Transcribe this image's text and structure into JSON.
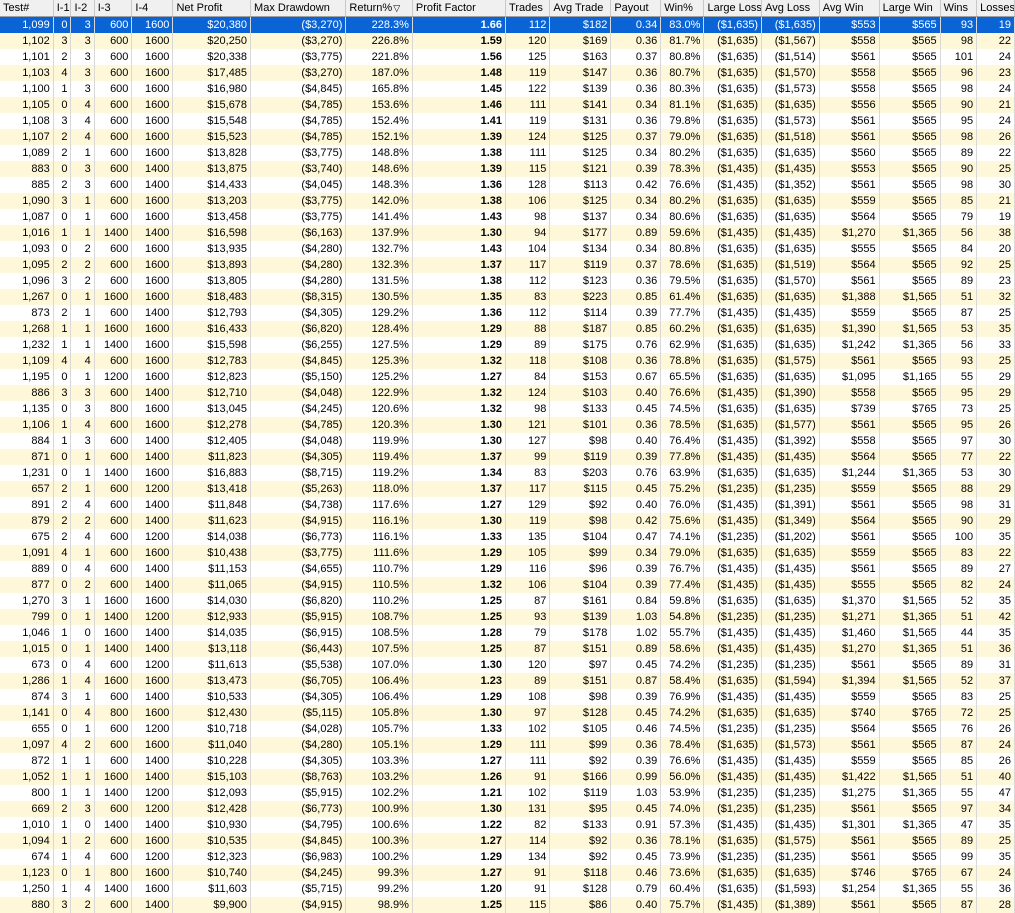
{
  "headers": [
    "Test#",
    "I-1",
    "I-2",
    "I-3",
    "I-4",
    "Net Profit",
    "Max Drawdown",
    "Return%",
    "Profit Factor",
    "Trades",
    "Avg Trade",
    "Payout",
    "Win%",
    "Large Loss",
    "Avg Loss",
    "Avg Win",
    "Large Win",
    "Wins",
    "Losses"
  ],
  "sort_column": "Return%",
  "sort_indicator": "▽",
  "selected_row": 0,
  "colors": {
    "selected_bg": "#0a64d6",
    "alt_row_bg": "#fff8d8",
    "header_bg": "#f0f0f0"
  },
  "rows": [
    [
      "1,099",
      "0",
      "3",
      "600",
      "1600",
      "$20,380",
      "($3,270)",
      "228.3%",
      "1.66",
      "112",
      "$182",
      "0.34",
      "83.0%",
      "($1,635)",
      "($1,635)",
      "$553",
      "$565",
      "93",
      "19"
    ],
    [
      "1,102",
      "3",
      "3",
      "600",
      "1600",
      "$20,250",
      "($3,270)",
      "226.8%",
      "1.59",
      "120",
      "$169",
      "0.36",
      "81.7%",
      "($1,635)",
      "($1,567)",
      "$558",
      "$565",
      "98",
      "22"
    ],
    [
      "1,101",
      "2",
      "3",
      "600",
      "1600",
      "$20,338",
      "($3,775)",
      "221.8%",
      "1.56",
      "125",
      "$163",
      "0.37",
      "80.8%",
      "($1,635)",
      "($1,514)",
      "$561",
      "$565",
      "101",
      "24"
    ],
    [
      "1,103",
      "4",
      "3",
      "600",
      "1600",
      "$17,485",
      "($3,270)",
      "187.0%",
      "1.48",
      "119",
      "$147",
      "0.36",
      "80.7%",
      "($1,635)",
      "($1,570)",
      "$558",
      "$565",
      "96",
      "23"
    ],
    [
      "1,100",
      "1",
      "3",
      "600",
      "1600",
      "$16,980",
      "($4,845)",
      "165.8%",
      "1.45",
      "122",
      "$139",
      "0.36",
      "80.3%",
      "($1,635)",
      "($1,573)",
      "$558",
      "$565",
      "98",
      "24"
    ],
    [
      "1,105",
      "0",
      "4",
      "600",
      "1600",
      "$15,678",
      "($4,785)",
      "153.6%",
      "1.46",
      "111",
      "$141",
      "0.34",
      "81.1%",
      "($1,635)",
      "($1,635)",
      "$556",
      "$565",
      "90",
      "21"
    ],
    [
      "1,108",
      "3",
      "4",
      "600",
      "1600",
      "$15,548",
      "($4,785)",
      "152.4%",
      "1.41",
      "119",
      "$131",
      "0.36",
      "79.8%",
      "($1,635)",
      "($1,573)",
      "$561",
      "$565",
      "95",
      "24"
    ],
    [
      "1,107",
      "2",
      "4",
      "600",
      "1600",
      "$15,523",
      "($4,785)",
      "152.1%",
      "1.39",
      "124",
      "$125",
      "0.37",
      "79.0%",
      "($1,635)",
      "($1,518)",
      "$561",
      "$565",
      "98",
      "26"
    ],
    [
      "1,089",
      "2",
      "1",
      "600",
      "1600",
      "$13,828",
      "($3,775)",
      "148.8%",
      "1.38",
      "111",
      "$125",
      "0.34",
      "80.2%",
      "($1,635)",
      "($1,635)",
      "$560",
      "$565",
      "89",
      "22"
    ],
    [
      "883",
      "0",
      "3",
      "600",
      "1400",
      "$13,875",
      "($3,740)",
      "148.6%",
      "1.39",
      "115",
      "$121",
      "0.39",
      "78.3%",
      "($1,435)",
      "($1,435)",
      "$553",
      "$565",
      "90",
      "25"
    ],
    [
      "885",
      "2",
      "3",
      "600",
      "1400",
      "$14,433",
      "($4,045)",
      "148.3%",
      "1.36",
      "128",
      "$113",
      "0.42",
      "76.6%",
      "($1,435)",
      "($1,352)",
      "$561",
      "$565",
      "98",
      "30"
    ],
    [
      "1,090",
      "3",
      "1",
      "600",
      "1600",
      "$13,203",
      "($3,775)",
      "142.0%",
      "1.38",
      "106",
      "$125",
      "0.34",
      "80.2%",
      "($1,635)",
      "($1,635)",
      "$559",
      "$565",
      "85",
      "21"
    ],
    [
      "1,087",
      "0",
      "1",
      "600",
      "1600",
      "$13,458",
      "($3,775)",
      "141.4%",
      "1.43",
      "98",
      "$137",
      "0.34",
      "80.6%",
      "($1,635)",
      "($1,635)",
      "$564",
      "$565",
      "79",
      "19"
    ],
    [
      "1,016",
      "1",
      "1",
      "1400",
      "1400",
      "$16,598",
      "($6,163)",
      "137.9%",
      "1.30",
      "94",
      "$177",
      "0.89",
      "59.6%",
      "($1,435)",
      "($1,435)",
      "$1,270",
      "$1,365",
      "56",
      "38"
    ],
    [
      "1,093",
      "0",
      "2",
      "600",
      "1600",
      "$13,935",
      "($4,280)",
      "132.7%",
      "1.43",
      "104",
      "$134",
      "0.34",
      "80.8%",
      "($1,635)",
      "($1,635)",
      "$555",
      "$565",
      "84",
      "20"
    ],
    [
      "1,095",
      "2",
      "2",
      "600",
      "1600",
      "$13,893",
      "($4,280)",
      "132.3%",
      "1.37",
      "117",
      "$119",
      "0.37",
      "78.6%",
      "($1,635)",
      "($1,519)",
      "$564",
      "$565",
      "92",
      "25"
    ],
    [
      "1,096",
      "3",
      "2",
      "600",
      "1600",
      "$13,805",
      "($4,280)",
      "131.5%",
      "1.38",
      "112",
      "$123",
      "0.36",
      "79.5%",
      "($1,635)",
      "($1,570)",
      "$561",
      "$565",
      "89",
      "23"
    ],
    [
      "1,267",
      "0",
      "1",
      "1600",
      "1600",
      "$18,483",
      "($8,315)",
      "130.5%",
      "1.35",
      "83",
      "$223",
      "0.85",
      "61.4%",
      "($1,635)",
      "($1,635)",
      "$1,388",
      "$1,565",
      "51",
      "32"
    ],
    [
      "873",
      "2",
      "1",
      "600",
      "1400",
      "$12,793",
      "($4,305)",
      "129.2%",
      "1.36",
      "112",
      "$114",
      "0.39",
      "77.7%",
      "($1,435)",
      "($1,435)",
      "$559",
      "$565",
      "87",
      "25"
    ],
    [
      "1,268",
      "1",
      "1",
      "1600",
      "1600",
      "$16,433",
      "($6,820)",
      "128.4%",
      "1.29",
      "88",
      "$187",
      "0.85",
      "60.2%",
      "($1,635)",
      "($1,635)",
      "$1,390",
      "$1,565",
      "53",
      "35"
    ],
    [
      "1,232",
      "1",
      "1",
      "1400",
      "1600",
      "$15,598",
      "($6,255)",
      "127.5%",
      "1.29",
      "89",
      "$175",
      "0.76",
      "62.9%",
      "($1,635)",
      "($1,635)",
      "$1,242",
      "$1,365",
      "56",
      "33"
    ],
    [
      "1,109",
      "4",
      "4",
      "600",
      "1600",
      "$12,783",
      "($4,845)",
      "125.3%",
      "1.32",
      "118",
      "$108",
      "0.36",
      "78.8%",
      "($1,635)",
      "($1,575)",
      "$561",
      "$565",
      "93",
      "25"
    ],
    [
      "1,195",
      "0",
      "1",
      "1200",
      "1600",
      "$12,823",
      "($5,150)",
      "125.2%",
      "1.27",
      "84",
      "$153",
      "0.67",
      "65.5%",
      "($1,635)",
      "($1,635)",
      "$1,095",
      "$1,165",
      "55",
      "29"
    ],
    [
      "886",
      "3",
      "3",
      "600",
      "1400",
      "$12,710",
      "($4,048)",
      "122.9%",
      "1.32",
      "124",
      "$103",
      "0.40",
      "76.6%",
      "($1,435)",
      "($1,390)",
      "$558",
      "$565",
      "95",
      "29"
    ],
    [
      "1,135",
      "0",
      "3",
      "800",
      "1600",
      "$13,045",
      "($4,245)",
      "120.6%",
      "1.32",
      "98",
      "$133",
      "0.45",
      "74.5%",
      "($1,635)",
      "($1,635)",
      "$739",
      "$765",
      "73",
      "25"
    ],
    [
      "1,106",
      "1",
      "4",
      "600",
      "1600",
      "$12,278",
      "($4,785)",
      "120.3%",
      "1.30",
      "121",
      "$101",
      "0.36",
      "78.5%",
      "($1,635)",
      "($1,577)",
      "$561",
      "$565",
      "95",
      "26"
    ],
    [
      "884",
      "1",
      "3",
      "600",
      "1400",
      "$12,405",
      "($4,048)",
      "119.9%",
      "1.30",
      "127",
      "$98",
      "0.40",
      "76.4%",
      "($1,435)",
      "($1,392)",
      "$558",
      "$565",
      "97",
      "30"
    ],
    [
      "871",
      "0",
      "1",
      "600",
      "1400",
      "$11,823",
      "($4,305)",
      "119.4%",
      "1.37",
      "99",
      "$119",
      "0.39",
      "77.8%",
      "($1,435)",
      "($1,435)",
      "$564",
      "$565",
      "77",
      "22"
    ],
    [
      "1,231",
      "0",
      "1",
      "1400",
      "1600",
      "$16,883",
      "($8,715)",
      "119.2%",
      "1.34",
      "83",
      "$203",
      "0.76",
      "63.9%",
      "($1,635)",
      "($1,635)",
      "$1,244",
      "$1,365",
      "53",
      "30"
    ],
    [
      "657",
      "2",
      "1",
      "600",
      "1200",
      "$13,418",
      "($5,263)",
      "118.0%",
      "1.37",
      "117",
      "$115",
      "0.45",
      "75.2%",
      "($1,235)",
      "($1,235)",
      "$559",
      "$565",
      "88",
      "29"
    ],
    [
      "891",
      "2",
      "4",
      "600",
      "1400",
      "$11,848",
      "($4,738)",
      "117.6%",
      "1.27",
      "129",
      "$92",
      "0.40",
      "76.0%",
      "($1,435)",
      "($1,391)",
      "$561",
      "$565",
      "98",
      "31"
    ],
    [
      "879",
      "2",
      "2",
      "600",
      "1400",
      "$11,623",
      "($4,915)",
      "116.1%",
      "1.30",
      "119",
      "$98",
      "0.42",
      "75.6%",
      "($1,435)",
      "($1,349)",
      "$564",
      "$565",
      "90",
      "29"
    ],
    [
      "675",
      "2",
      "4",
      "600",
      "1200",
      "$14,038",
      "($6,773)",
      "116.1%",
      "1.33",
      "135",
      "$104",
      "0.47",
      "74.1%",
      "($1,235)",
      "($1,202)",
      "$561",
      "$565",
      "100",
      "35"
    ],
    [
      "1,091",
      "4",
      "1",
      "600",
      "1600",
      "$10,438",
      "($3,775)",
      "111.6%",
      "1.29",
      "105",
      "$99",
      "0.34",
      "79.0%",
      "($1,635)",
      "($1,635)",
      "$559",
      "$565",
      "83",
      "22"
    ],
    [
      "889",
      "0",
      "4",
      "600",
      "1400",
      "$11,153",
      "($4,655)",
      "110.7%",
      "1.29",
      "116",
      "$96",
      "0.39",
      "76.7%",
      "($1,435)",
      "($1,435)",
      "$561",
      "$565",
      "89",
      "27"
    ],
    [
      "877",
      "0",
      "2",
      "600",
      "1400",
      "$11,065",
      "($4,915)",
      "110.5%",
      "1.32",
      "106",
      "$104",
      "0.39",
      "77.4%",
      "($1,435)",
      "($1,435)",
      "$555",
      "$565",
      "82",
      "24"
    ],
    [
      "1,270",
      "3",
      "1",
      "1600",
      "1600",
      "$14,030",
      "($6,820)",
      "110.2%",
      "1.25",
      "87",
      "$161",
      "0.84",
      "59.8%",
      "($1,635)",
      "($1,635)",
      "$1,370",
      "$1,565",
      "52",
      "35"
    ],
    [
      "799",
      "0",
      "1",
      "1400",
      "1200",
      "$12,933",
      "($5,915)",
      "108.7%",
      "1.25",
      "93",
      "$139",
      "1.03",
      "54.8%",
      "($1,235)",
      "($1,235)",
      "$1,271",
      "$1,365",
      "51",
      "42"
    ],
    [
      "1,046",
      "1",
      "0",
      "1600",
      "1400",
      "$14,035",
      "($6,915)",
      "108.5%",
      "1.28",
      "79",
      "$178",
      "1.02",
      "55.7%",
      "($1,435)",
      "($1,435)",
      "$1,460",
      "$1,565",
      "44",
      "35"
    ],
    [
      "1,015",
      "0",
      "1",
      "1400",
      "1400",
      "$13,118",
      "($6,443)",
      "107.5%",
      "1.25",
      "87",
      "$151",
      "0.89",
      "58.6%",
      "($1,435)",
      "($1,435)",
      "$1,270",
      "$1,365",
      "51",
      "36"
    ],
    [
      "673",
      "0",
      "4",
      "600",
      "1200",
      "$11,613",
      "($5,538)",
      "107.0%",
      "1.30",
      "120",
      "$97",
      "0.45",
      "74.2%",
      "($1,235)",
      "($1,235)",
      "$561",
      "$565",
      "89",
      "31"
    ],
    [
      "1,286",
      "1",
      "4",
      "1600",
      "1600",
      "$13,473",
      "($6,705)",
      "106.4%",
      "1.23",
      "89",
      "$151",
      "0.87",
      "58.4%",
      "($1,635)",
      "($1,594)",
      "$1,394",
      "$1,565",
      "52",
      "37"
    ],
    [
      "874",
      "3",
      "1",
      "600",
      "1400",
      "$10,533",
      "($4,305)",
      "106.4%",
      "1.29",
      "108",
      "$98",
      "0.39",
      "76.9%",
      "($1,435)",
      "($1,435)",
      "$559",
      "$565",
      "83",
      "25"
    ],
    [
      "1,141",
      "0",
      "4",
      "800",
      "1600",
      "$12,430",
      "($5,115)",
      "105.8%",
      "1.30",
      "97",
      "$128",
      "0.45",
      "74.2%",
      "($1,635)",
      "($1,635)",
      "$740",
      "$765",
      "72",
      "25"
    ],
    [
      "655",
      "0",
      "1",
      "600",
      "1200",
      "$10,718",
      "($4,028)",
      "105.7%",
      "1.33",
      "102",
      "$105",
      "0.46",
      "74.5%",
      "($1,235)",
      "($1,235)",
      "$564",
      "$565",
      "76",
      "26"
    ],
    [
      "1,097",
      "4",
      "2",
      "600",
      "1600",
      "$11,040",
      "($4,280)",
      "105.1%",
      "1.29",
      "111",
      "$99",
      "0.36",
      "78.4%",
      "($1,635)",
      "($1,573)",
      "$561",
      "$565",
      "87",
      "24"
    ],
    [
      "872",
      "1",
      "1",
      "600",
      "1400",
      "$10,228",
      "($4,305)",
      "103.3%",
      "1.27",
      "111",
      "$92",
      "0.39",
      "76.6%",
      "($1,435)",
      "($1,435)",
      "$559",
      "$565",
      "85",
      "26"
    ],
    [
      "1,052",
      "1",
      "1",
      "1600",
      "1400",
      "$15,103",
      "($8,763)",
      "103.2%",
      "1.26",
      "91",
      "$166",
      "0.99",
      "56.0%",
      "($1,435)",
      "($1,435)",
      "$1,422",
      "$1,565",
      "51",
      "40"
    ],
    [
      "800",
      "1",
      "1",
      "1400",
      "1200",
      "$12,093",
      "($5,915)",
      "102.2%",
      "1.21",
      "102",
      "$119",
      "1.03",
      "53.9%",
      "($1,235)",
      "($1,235)",
      "$1,275",
      "$1,365",
      "55",
      "47"
    ],
    [
      "669",
      "2",
      "3",
      "600",
      "1200",
      "$12,428",
      "($6,773)",
      "100.9%",
      "1.30",
      "131",
      "$95",
      "0.45",
      "74.0%",
      "($1,235)",
      "($1,235)",
      "$561",
      "$565",
      "97",
      "34"
    ],
    [
      "1,010",
      "1",
      "0",
      "1400",
      "1400",
      "$10,930",
      "($4,795)",
      "100.6%",
      "1.22",
      "82",
      "$133",
      "0.91",
      "57.3%",
      "($1,435)",
      "($1,435)",
      "$1,301",
      "$1,365",
      "47",
      "35"
    ],
    [
      "1,094",
      "1",
      "2",
      "600",
      "1600",
      "$10,535",
      "($4,845)",
      "100.3%",
      "1.27",
      "114",
      "$92",
      "0.36",
      "78.1%",
      "($1,635)",
      "($1,575)",
      "$561",
      "$565",
      "89",
      "25"
    ],
    [
      "674",
      "1",
      "4",
      "600",
      "1200",
      "$12,323",
      "($6,983)",
      "100.2%",
      "1.29",
      "134",
      "$92",
      "0.45",
      "73.9%",
      "($1,235)",
      "($1,235)",
      "$561",
      "$565",
      "99",
      "35"
    ],
    [
      "1,123",
      "0",
      "1",
      "800",
      "1600",
      "$10,740",
      "($4,245)",
      "99.3%",
      "1.27",
      "91",
      "$118",
      "0.46",
      "73.6%",
      "($1,635)",
      "($1,635)",
      "$746",
      "$765",
      "67",
      "24"
    ],
    [
      "1,250",
      "1",
      "4",
      "1400",
      "1600",
      "$11,603",
      "($5,715)",
      "99.2%",
      "1.20",
      "91",
      "$128",
      "0.79",
      "60.4%",
      "($1,635)",
      "($1,593)",
      "$1,254",
      "$1,365",
      "55",
      "36"
    ],
    [
      "880",
      "3",
      "2",
      "600",
      "1400",
      "$9,900",
      "($4,915)",
      "98.9%",
      "1.25",
      "115",
      "$86",
      "0.40",
      "75.7%",
      "($1,435)",
      "($1,389)",
      "$561",
      "$565",
      "87",
      "28"
    ]
  ]
}
